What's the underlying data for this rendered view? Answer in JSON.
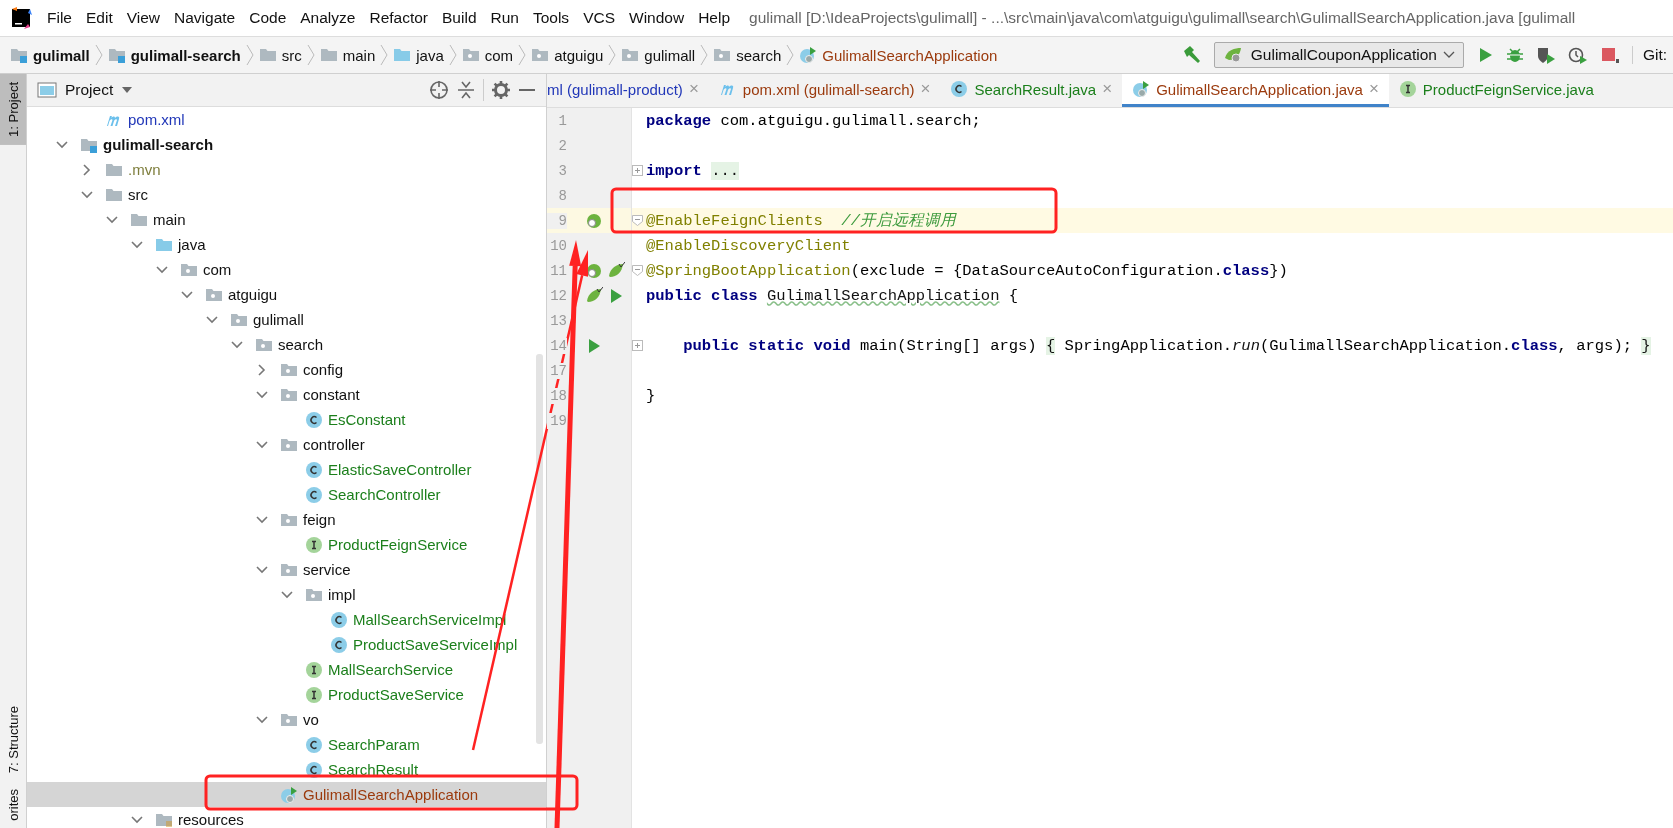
{
  "window": {
    "title": "gulimall [D:\\IdeaProjects\\gulimall] - ...\\src\\main\\java\\com\\atguigu\\gulimall\\search\\GulimallSearchApplication.java [gulimall"
  },
  "menu": [
    "File",
    "Edit",
    "View",
    "Navigate",
    "Code",
    "Analyze",
    "Refactor",
    "Build",
    "Run",
    "Tools",
    "VCS",
    "Window",
    "Help"
  ],
  "breadcrumbs": [
    {
      "label": "gulimall",
      "kind": "module"
    },
    {
      "label": "gulimall-search",
      "kind": "module"
    },
    {
      "label": "src",
      "kind": "folder"
    },
    {
      "label": "main",
      "kind": "folder"
    },
    {
      "label": "java",
      "kind": "source"
    },
    {
      "label": "com",
      "kind": "package"
    },
    {
      "label": "atguigu",
      "kind": "package"
    },
    {
      "label": "gulimall",
      "kind": "package"
    },
    {
      "label": "search",
      "kind": "package"
    },
    {
      "label": "GulimallSearchApplication",
      "kind": "app"
    }
  ],
  "toolbar": {
    "run_config": "GulimallCouponApplication",
    "vcs_label": "Git:"
  },
  "tool_stripe": [
    {
      "label": "1: Project",
      "selected": true
    },
    {
      "label": "7: Structure",
      "selected": false
    },
    {
      "label": "orites",
      "selected": false
    }
  ],
  "project_panel": {
    "title": "Project",
    "tree": [
      {
        "children": [
          {
            "label": "pom.xml",
            "kind": "maven",
            "color": "#2137b8"
          }
        ]
      },
      {
        "label": "gulimall-search",
        "kind": "module",
        "expanded": true,
        "children": [
          {
            "label": ".mvn",
            "kind": "folder",
            "expanded": false,
            "color": "#7e7e3c"
          },
          {
            "label": "src",
            "kind": "folder",
            "expanded": true,
            "children": [
              {
                "label": "main",
                "kind": "folder",
                "expanded": true,
                "children": [
                  {
                    "label": "java",
                    "kind": "source",
                    "expanded": true,
                    "children": [
                      {
                        "label": "com",
                        "kind": "package",
                        "expanded": true,
                        "children": [
                          {
                            "label": "atguigu",
                            "kind": "package",
                            "expanded": true,
                            "children": [
                              {
                                "label": "gulimall",
                                "kind": "package",
                                "expanded": true,
                                "children": [
                                  {
                                    "label": "search",
                                    "kind": "package",
                                    "expanded": true,
                                    "children": [
                                      {
                                        "label": "config",
                                        "kind": "package",
                                        "expanded": false
                                      },
                                      {
                                        "label": "constant",
                                        "kind": "package",
                                        "expanded": true,
                                        "children": [
                                          {
                                            "label": "EsConstant",
                                            "kind": "class",
                                            "color": "#1b7f1b"
                                          }
                                        ]
                                      },
                                      {
                                        "label": "controller",
                                        "kind": "package",
                                        "expanded": true,
                                        "children": [
                                          {
                                            "label": "ElasticSaveController",
                                            "kind": "class",
                                            "color": "#1b7f1b"
                                          },
                                          {
                                            "label": "SearchController",
                                            "kind": "class",
                                            "color": "#1b7f1b"
                                          }
                                        ]
                                      },
                                      {
                                        "label": "feign",
                                        "kind": "package",
                                        "expanded": true,
                                        "children": [
                                          {
                                            "label": "ProductFeignService",
                                            "kind": "interface",
                                            "color": "#1b7f1b"
                                          }
                                        ]
                                      },
                                      {
                                        "label": "service",
                                        "kind": "package",
                                        "expanded": true,
                                        "children": [
                                          {
                                            "label": "impl",
                                            "kind": "package",
                                            "expanded": true,
                                            "children": [
                                              {
                                                "label": "MallSearchServiceImpl",
                                                "kind": "class",
                                                "color": "#1b7f1b"
                                              },
                                              {
                                                "label": "ProductSaveServiceImpl",
                                                "kind": "class",
                                                "color": "#1b7f1b"
                                              }
                                            ]
                                          },
                                          {
                                            "label": "MallSearchService",
                                            "kind": "interface",
                                            "color": "#1b7f1b"
                                          },
                                          {
                                            "label": "ProductSaveService",
                                            "kind": "interface",
                                            "color": "#1b7f1b"
                                          }
                                        ]
                                      },
                                      {
                                        "label": "vo",
                                        "kind": "package",
                                        "expanded": true,
                                        "children": [
                                          {
                                            "label": "SearchParam",
                                            "kind": "class",
                                            "color": "#1b7f1b"
                                          },
                                          {
                                            "label": "SearchResult",
                                            "kind": "class",
                                            "color": "#1b7f1b"
                                          }
                                        ]
                                      },
                                      {
                                        "label": "GulimallSearchApplication",
                                        "kind": "app",
                                        "color": "#9b3a0d",
                                        "selected": true
                                      }
                                    ]
                                  }
                                ]
                              }
                            ]
                          }
                        ]
                      }
                    ]
                  },
                  {
                    "label": "resources",
                    "kind": "resources",
                    "expanded": true
                  }
                ]
              }
            ]
          }
        ]
      }
    ]
  },
  "editor_tabs": [
    {
      "label": "ml (gulimall-product)",
      "color": "#2137b8",
      "close": "×",
      "selected": false
    },
    {
      "label": "pom.xml (gulimall-search)",
      "kind": "maven",
      "color": "#9b3a0d",
      "close": "×",
      "selected": false
    },
    {
      "label": "SearchResult.java",
      "kind": "class",
      "color": "#1b7f1b",
      "close": "×",
      "selected": false
    },
    {
      "label": "GulimallSearchApplication.java",
      "kind": "app",
      "color": "#9b3a0d",
      "close": "×",
      "selected": true
    },
    {
      "label": "ProductFeignService.java",
      "kind": "interface",
      "color": "#1b7f1b",
      "selected": false
    }
  ],
  "code_lines": [
    {
      "number": "1",
      "tokens": [
        {
          "kind": "keyword",
          "text": "package "
        },
        {
          "kind": "plain",
          "text": "com.atguigu.gulimall.search;"
        }
      ]
    },
    {
      "number": "2"
    },
    {
      "number": "3",
      "fold": {
        "kind": "collapsed"
      },
      "tokens": [
        {
          "kind": "keyword",
          "text": "import "
        },
        {
          "kind": "folded",
          "text": "..."
        }
      ]
    },
    {
      "number": "8"
    },
    {
      "number": "9",
      "highlighted": true,
      "fold": {
        "kind": "start"
      },
      "gutter": [
        {
          "kind": "bean"
        }
      ],
      "tokens": [
        {
          "kind": "annotation",
          "text": "@EnableFeignClients"
        },
        {
          "kind": "comment",
          "text": "  //开启远程调用"
        }
      ]
    },
    {
      "number": "10",
      "tokens": [
        {
          "kind": "annotation",
          "text": "@EnableDiscoveryClient"
        }
      ]
    },
    {
      "number": "11",
      "fold": {
        "kind": "start"
      },
      "gutter": [
        {
          "kind": "bean"
        },
        {
          "kind": "spring"
        }
      ],
      "tokens": [
        {
          "kind": "annotation",
          "text": "@SpringBootApplication"
        },
        {
          "kind": "plain",
          "text": "(exclude = {DataSourceAutoConfiguration."
        },
        {
          "kind": "keyword",
          "text": "class"
        },
        {
          "kind": "plain",
          "text": "})"
        }
      ]
    },
    {
      "number": "12",
      "gutter": [
        {
          "kind": "spring"
        },
        {
          "kind": "run"
        }
      ],
      "tokens": [
        {
          "kind": "keyword",
          "text": "public class "
        },
        {
          "kind": "typo",
          "text": "GulimallSearchApplication"
        },
        {
          "kind": "plain",
          "text": " {"
        }
      ]
    },
    {
      "number": "13"
    },
    {
      "number": "14",
      "fold": {
        "kind": "collapsed"
      },
      "gutter": [
        {
          "kind": "run"
        }
      ],
      "tokens": [
        {
          "kind": "keyword",
          "text": "    public static void"
        },
        {
          "kind": "plain",
          "text": " main(String[] args) "
        },
        {
          "kind": "folded",
          "text": "{"
        },
        {
          "kind": "plain",
          "text": " SpringApplication."
        },
        {
          "kind": "static",
          "text": "run"
        },
        {
          "kind": "plain",
          "text": "(GulimallSearchApplication."
        },
        {
          "kind": "keyword",
          "text": "class"
        },
        {
          "kind": "plain",
          "text": ", args); "
        },
        {
          "kind": "folded",
          "text": "}"
        }
      ]
    },
    {
      "number": "17"
    },
    {
      "number": "18",
      "tokens": [
        {
          "kind": "plain",
          "text": "}"
        }
      ]
    },
    {
      "number": "19"
    }
  ],
  "annotations": [
    {
      "kind": "box"
    },
    {
      "kind": "box"
    },
    {
      "kind": "arrow"
    },
    {
      "kind": "arrow"
    }
  ]
}
